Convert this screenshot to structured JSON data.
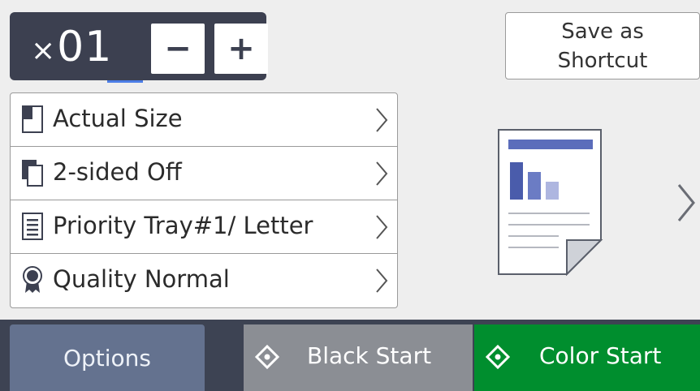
{
  "copy_counter": {
    "prefix": "×",
    "value": "01",
    "minus_label": "−",
    "plus_label": "+"
  },
  "shortcut_button": {
    "line1": "Save as",
    "line2": "Shortcut"
  },
  "settings": [
    {
      "label": "Actual Size",
      "icon": "page-size-icon"
    },
    {
      "label": "2-sided Off",
      "icon": "duplex-icon"
    },
    {
      "label": "Priority Tray#1/ Letter",
      "icon": "tray-icon"
    },
    {
      "label": "Quality Normal",
      "icon": "quality-ribbon-icon"
    }
  ],
  "bottom_bar": {
    "options_label": "Options",
    "black_start_label": "Black Start",
    "color_start_label": "Color Start"
  },
  "colors": {
    "counter_bg": "#3c4050",
    "options_bg": "#64728f",
    "black_start_bg": "#8b8e94",
    "color_start_bg": "#008e2e",
    "preview_accent": "#5b6dbb"
  }
}
